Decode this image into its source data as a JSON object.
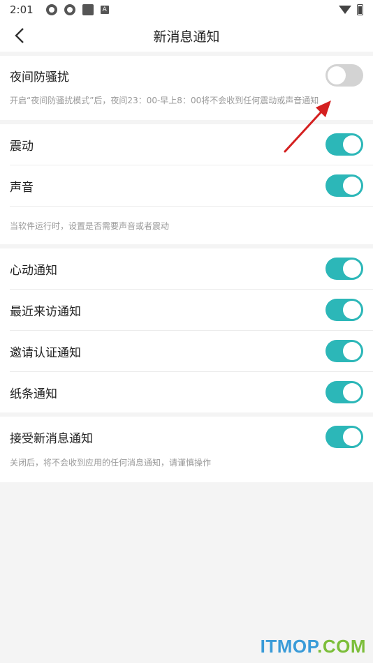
{
  "status_bar": {
    "time": "2:01",
    "icons": [
      "gear-icon",
      "gear-icon",
      "square-icon",
      "a-icon"
    ],
    "right_icons": [
      "wifi-icon",
      "battery-icon"
    ]
  },
  "header": {
    "title": "新消息通知",
    "back_icon": "chevron-left-icon"
  },
  "sections": {
    "dnd": {
      "label": "夜间防骚扰",
      "on": false,
      "hint": "开启“夜间防骚扰模式”后，夜间23：00-早上8：00将不会收到任何震动或声音通知"
    },
    "vibrate": {
      "label": "震动",
      "on": true
    },
    "sound": {
      "label": "声音",
      "on": true
    },
    "sound_hint": "当软件运行时，设置是否需要声音或者震动",
    "heart": {
      "label": "心动通知",
      "on": true
    },
    "visitor": {
      "label": "最近来访通知",
      "on": true
    },
    "invite": {
      "label": "邀请认证通知",
      "on": true
    },
    "note": {
      "label": "纸条通知",
      "on": true
    },
    "accept": {
      "label": "接受新消息通知",
      "on": true,
      "hint": "关闭后，将不会收到应用的任何消息通知，请谨慎操作"
    }
  },
  "colors": {
    "toggle_on": "#2cb7b8",
    "toggle_off": "#d3d3d3",
    "arrow": "#d42020"
  },
  "watermark": {
    "part1": "ITMOP",
    "part2": ".COM"
  }
}
